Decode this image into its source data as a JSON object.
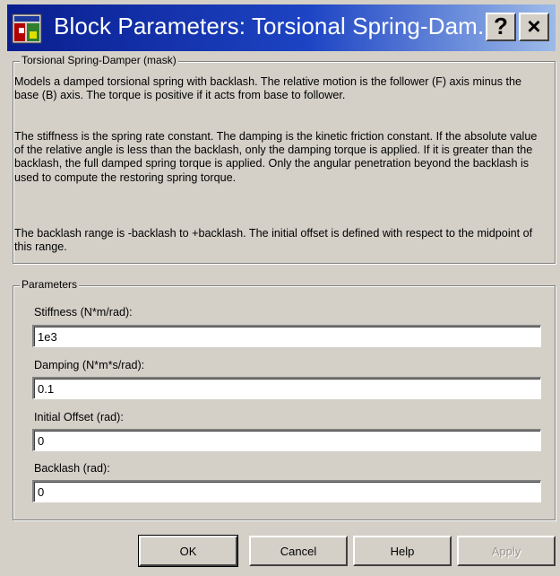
{
  "window": {
    "title": "Block Parameters: Torsional  Spring-Dam...",
    "help_glyph": "?",
    "close_glyph": "×",
    "icon": "simulink-block-icon"
  },
  "description_group": {
    "legend": "Torsional Spring-Damper (mask)",
    "paragraphs": [
      "Models a damped torsional spring with backlash.  The relative motion is the follower (F) axis minus the base (B) axis. The torque is positive if it acts from base to follower.",
      "The stiffness is the spring rate constant. The damping is the kinetic friction constant. If the absolute value of the relative angle is less than the backlash, only the damping torque is applied. If it is greater than the backlash, the full damped spring torque is applied. Only the angular penetration beyond the backlash is used to compute the restoring spring torque.",
      "The backlash range is -backlash to +backlash. The initial offset is defined with respect to the midpoint of this range."
    ]
  },
  "parameters_group": {
    "legend": "Parameters",
    "fields": [
      {
        "label": "Stiffness (N*m/rad):",
        "value": "1e3"
      },
      {
        "label": "Damping (N*m*s/rad):",
        "value": "0.1"
      },
      {
        "label": "Initial Offset (rad):",
        "value": "0"
      },
      {
        "label": "Backlash (rad):",
        "value": "0"
      }
    ]
  },
  "buttons": {
    "ok": "OK",
    "cancel": "Cancel",
    "help": "Help",
    "apply": "Apply"
  }
}
